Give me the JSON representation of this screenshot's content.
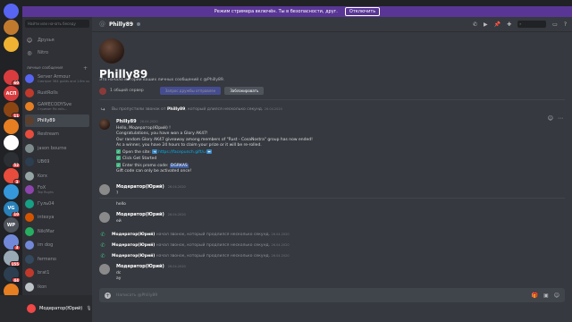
{
  "banner": {
    "text": "Режим стримера включён. Ты в безопасности, друг.",
    "disable_label": "Отключить",
    "bg": "#593695"
  },
  "rail": {
    "servers": [
      {
        "label": "",
        "color": "#5865f2",
        "badge": ""
      },
      {
        "label": "",
        "color": "#c17a2d",
        "badge": ""
      },
      {
        "label": "",
        "color": "#f0b232",
        "badge": ""
      },
      {
        "label": "",
        "color": "#202225",
        "badge": ""
      },
      {
        "label": "",
        "color": "#d83c3e",
        "badge": "60"
      },
      {
        "label": "АСП",
        "color": "#d83c3e",
        "badge": ""
      },
      {
        "label": "",
        "color": "#8b4513",
        "badge": "11"
      },
      {
        "label": "",
        "color": "#e67e22",
        "badge": ""
      },
      {
        "label": "",
        "color": "#ffffff",
        "badge": ""
      },
      {
        "label": "",
        "color": "#2c2f33",
        "badge": "52"
      },
      {
        "label": "",
        "color": "#e74c3c",
        "badge": "3"
      },
      {
        "label": "",
        "color": "#3498db",
        "badge": ""
      },
      {
        "label": "VG",
        "color": "#2980b9",
        "badge": "10"
      },
      {
        "label": "WP",
        "color": "#4f545c",
        "badge": ""
      },
      {
        "label": "",
        "color": "#7289da",
        "badge": "3"
      },
      {
        "label": "",
        "color": "#99aab5",
        "badge": "155"
      },
      {
        "label": "",
        "color": "#2c3e50",
        "badge": "44"
      },
      {
        "label": "",
        "color": "#e67e22",
        "badge": ""
      },
      {
        "label": "НОВОЕ",
        "color": "#f04747",
        "badge": ""
      }
    ]
  },
  "sidebar": {
    "search_placeholder": "Найти или начать беседу",
    "nav": [
      {
        "icon": "friends-icon",
        "glyph": "☺",
        "label": "Друзья"
      },
      {
        "icon": "nitro-icon",
        "glyph": "◎",
        "label": "Nitro"
      }
    ],
    "dm_header": "личные сообщения",
    "dm_add": "+",
    "dms": [
      {
        "name": "Server Armour",
        "sub": "Смотрит 364 guilds and 1.6m us...",
        "color": "#5865f2",
        "active": false
      },
      {
        "name": "RustRolls",
        "sub": "",
        "color": "#c0392b",
        "active": false
      },
      {
        "name": "GAMECODYSve",
        "sub": "Стримит  Re-rolls...",
        "color": "#e67e22",
        "active": false
      },
      {
        "name": "Philly89",
        "sub": "",
        "color": "#5d3f2e",
        "active": true
      },
      {
        "name": "Restream",
        "sub": "",
        "color": "#e74c3c",
        "active": false
      },
      {
        "name": "jason bourne",
        "sub": "",
        "color": "#7f8c8d",
        "active": false
      },
      {
        "name": "UB69",
        "sub": "",
        "color": "#2c3e50",
        "active": false
      },
      {
        "name": "Korx",
        "sub": "",
        "color": "#95a5a6",
        "active": false
      },
      {
        "name": "FoX",
        "sub": "Top Rughs",
        "color": "#8e44ad",
        "active": false
      },
      {
        "name": "Гуль04",
        "sub": "",
        "color": "#16a085",
        "active": false
      },
      {
        "name": "intexya",
        "sub": "",
        "color": "#d35400",
        "active": false
      },
      {
        "name": "NikiMar",
        "sub": "",
        "color": "#27ae60",
        "active": false
      },
      {
        "name": "im dog",
        "sub": "",
        "color": "#7289da",
        "active": false
      },
      {
        "name": "fermeno",
        "sub": "",
        "color": "#34495e",
        "active": false
      },
      {
        "name": "brat1",
        "sub": "",
        "color": "#c0392b",
        "active": false
      },
      {
        "name": "lkon",
        "sub": "",
        "color": "#bdc3c7",
        "active": false
      },
      {
        "name": "grigoriz",
        "sub": "",
        "color": "#2980b9",
        "active": false
      }
    ]
  },
  "user_panel": {
    "name": "Модератор(Юрий)"
  },
  "header": {
    "channel": "Philly89"
  },
  "profile": {
    "name": "Philly89",
    "description": "Это начало истории ваших личных сообщений с @Philly89.",
    "mutual": "1 общий сервер",
    "request_label": "Запрос дружбы отправлен",
    "block_label": "Заблокировать"
  },
  "feed": {
    "missed_call": {
      "prefix": "Вы пропустили звонок от",
      "who": "Philly89",
      "suffix": ", который длился несколько секунд.",
      "time": "26.04.2020"
    },
    "main_message": {
      "author": "Philly89",
      "time": "26.04.2020",
      "lines": {
        "l1": "Hello, Модератор(Юрий) !",
        "l2": "Congratulations, you have won a Glory AK47!",
        "l3": "Our random Glory AK47 giveaway among members of \"Rust - CosaNostra\" group has now ended!",
        "l4": "As a winner, you have 24 hours to claim your prize or it will be re-rolled.",
        "l5_prefix": "Open the site:",
        "l5_link": "https://facepunch.gift/u",
        "l6": "Click Get Started",
        "l7_prefix": "Enter this promo code:",
        "l7_code": "DGRKAS",
        "l8": "Gift code can only be activated once!"
      }
    },
    "msg2": {
      "author": "Модератор(Юрий)",
      "time": "26.04.2020",
      "l1": "?",
      "l2": "hello"
    },
    "msg3": {
      "author": "Модератор(Юрий)",
      "time": "26.04.2020",
      "l1": "ей"
    },
    "calls": [
      {
        "who": "Модератор(Юрий)",
        "text": "начал звонок, который продлился несколько секунд.",
        "time": "26.04.2020"
      },
      {
        "who": "Модератор(Юрий)",
        "text": "начал звонок, который продлился несколько секунд.",
        "time": "26.04.2020"
      },
      {
        "who": "Модератор(Юрий)",
        "text": "начал звонок, который продлился несколько секунд.",
        "time": "26.04.2020"
      }
    ],
    "msg4": {
      "author": "Модератор(Юрий)",
      "time": "26.04.2020",
      "l1": "dc",
      "l2": "ау"
    }
  },
  "composer": {
    "placeholder": "Написать @Philly89"
  }
}
